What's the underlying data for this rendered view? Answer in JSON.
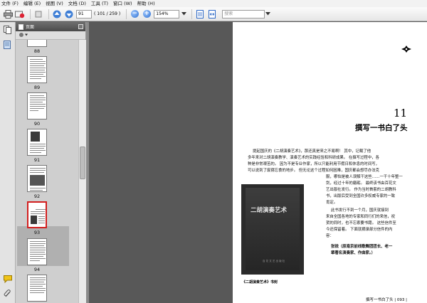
{
  "menu": [
    "文件 (F)",
    "编辑 (E)",
    "视图 (V)",
    "文档 (D)",
    "工具 (T)",
    "窗口 (W)",
    "帮助 (H)"
  ],
  "toolbar": {
    "page_current": "91",
    "page_total": "( 101 / 259 )",
    "zoom": "154%",
    "search_placeholder": "搜索"
  },
  "panel": {
    "title": "页面"
  },
  "thumbnails": [
    {
      "label": "88"
    },
    {
      "label": "89"
    },
    {
      "label": "90"
    },
    {
      "label": "91"
    },
    {
      "label": "92"
    },
    {
      "label": "93"
    },
    {
      "label": "94"
    }
  ],
  "document": {
    "chapter_number": "11",
    "chapter_title": "撰写一书白了头",
    "paragraph_lines": [
      "提起国庆的《二胡演奏艺术》，那还真是来之不易啊！ 其中，记载了他",
      "多年来对二胡演奏教学、演奏艺术的实践经验和科研成果。 在撰写过程中，各",
      "种是非常艰苦的。 因为不是专业作家，所以只能利用节假日和休息的时间写，",
      "可以说到了废寝忘食的地步。 但无论这个过程如何困难，国庆都会想尽办法克",
      "服，哪怕是被人误解干这些……一干十年整一",
      "剑，经过十年的磨砺。 最终该书由百花文",
      "艺出版社发行。 作为当时首套的二胡教科",
      "书，出版后受到全国许多权威专家的一致",
      "肯定。"
    ],
    "paragraph2_lines": [
      "此书发行不到一个月，国庆就接到",
      "来自全国各地的专家和同行们的来信，祝",
      "贺的同时，也不忘索要书籍。 这些信件至",
      "今还保留着。 下面就摘录部分信件的内",
      "容："
    ],
    "quote_lines": [
      "张锐（原南京前线歌舞团团长、老一",
      "辈著名演奏家、作曲家。）"
    ],
    "cover_title": "二胡演奏艺术",
    "cover_publisher": "百 花 文 艺 出 版 社",
    "caption": "《二胡演奏艺术》书封",
    "footer": "撰写一书白了头 | 093 |"
  }
}
